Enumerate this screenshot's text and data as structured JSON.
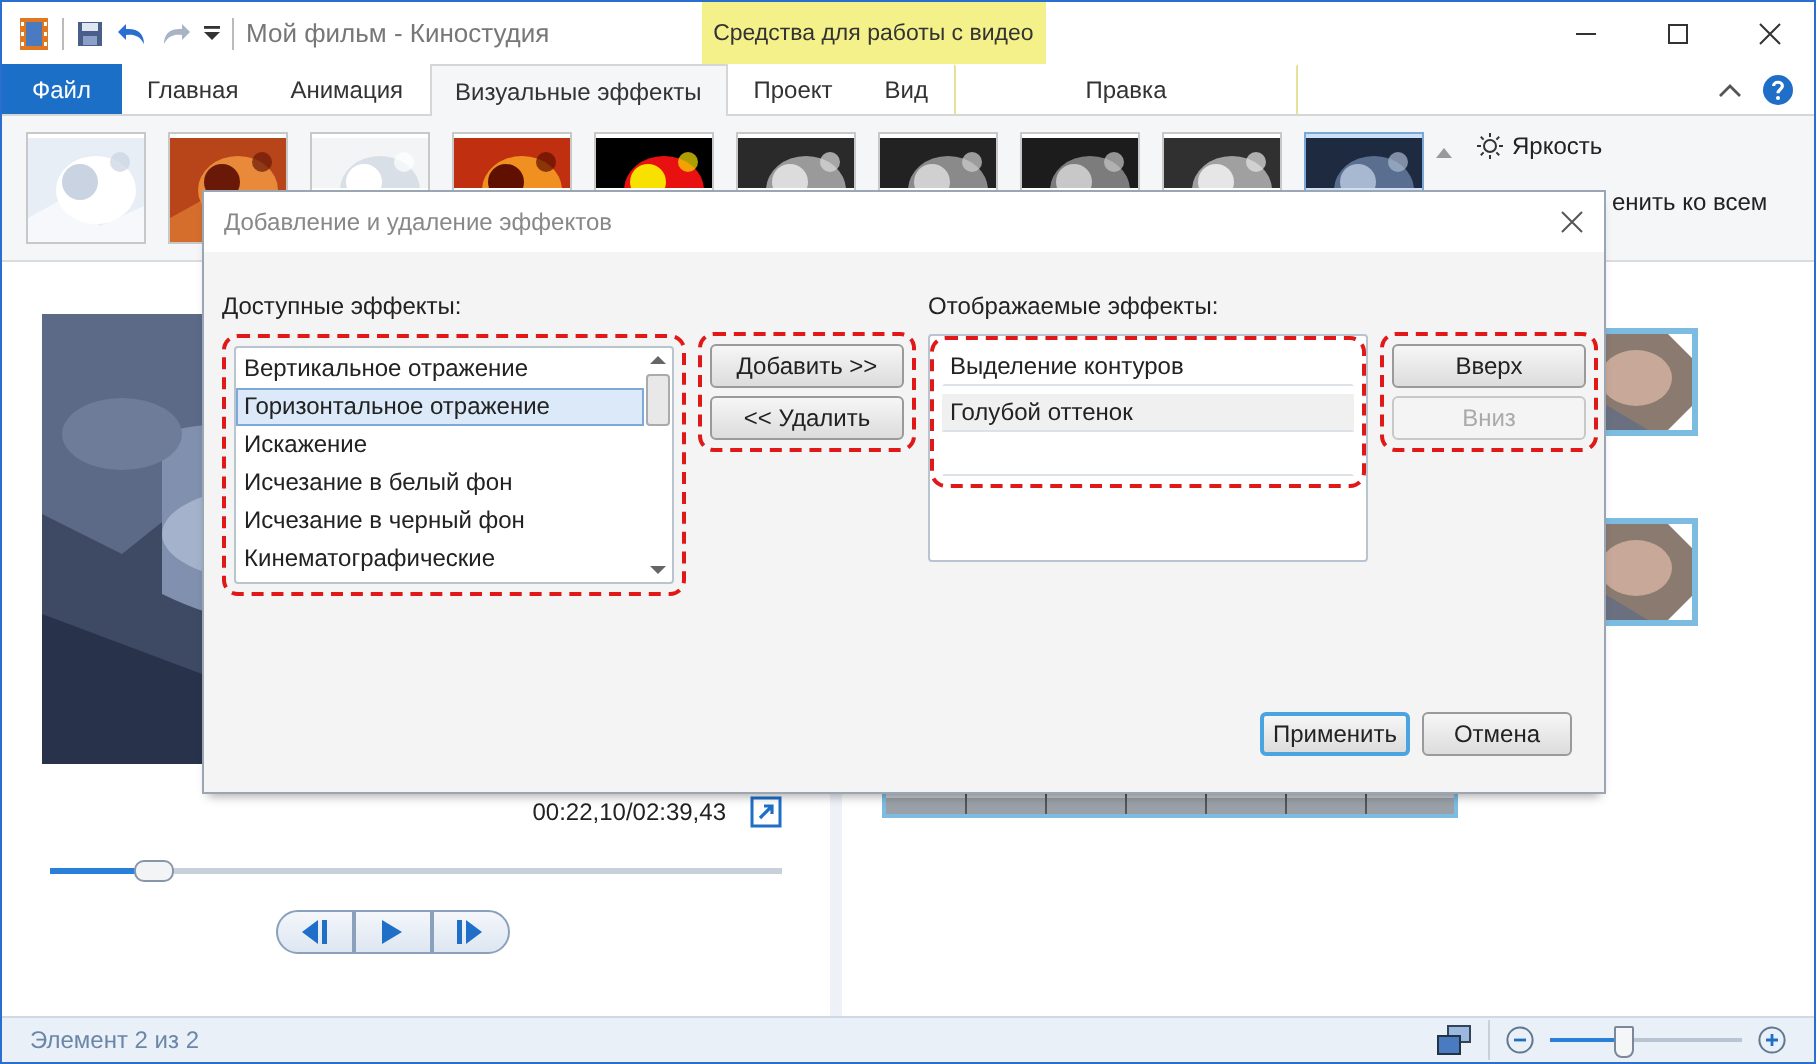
{
  "window": {
    "title": "Мой фильм - Киностудия",
    "context_group": "Средства для работы с видео"
  },
  "tabs": [
    {
      "label": "Файл",
      "kind": "file",
      "selected": false
    },
    {
      "label": "Главная",
      "kind": "tab",
      "selected": false
    },
    {
      "label": "Анимация",
      "kind": "tab",
      "selected": false
    },
    {
      "label": "Визуальные эффекты",
      "kind": "tab",
      "selected": true
    },
    {
      "label": "Проект",
      "kind": "tab",
      "selected": false
    },
    {
      "label": "Вид",
      "kind": "tab",
      "selected": false
    },
    {
      "label": "Правка",
      "kind": "context",
      "selected": false
    }
  ],
  "ribbon": {
    "gallery": [
      {
        "selected": false
      },
      {
        "selected": false
      },
      {
        "selected": false
      },
      {
        "selected": false
      },
      {
        "selected": false
      },
      {
        "selected": false
      },
      {
        "selected": false
      },
      {
        "selected": false
      },
      {
        "selected": false
      },
      {
        "selected": true
      }
    ],
    "commands": [
      "Яркость",
      "енить ко всем"
    ]
  },
  "preview": {
    "time": "00:22,10/02:39,43",
    "seek": {
      "level": 0.14
    }
  },
  "status_bar": {
    "text": "Элемент 2 из 2",
    "zoom": {
      "level": 0.38
    }
  },
  "dialog": {
    "title": "Добавление и удаление эффектов",
    "available": {
      "label": "Доступные эффекты:",
      "highlighted": true,
      "items": [
        {
          "label": "Вертикальное отражение",
          "selected": false
        },
        {
          "label": "Горизонтальное отражение",
          "selected": true
        },
        {
          "label": "Искажение",
          "selected": false
        },
        {
          "label": "Исчезание в белый фон",
          "selected": false
        },
        {
          "label": "Исчезание в черный фон",
          "selected": false
        },
        {
          "label": "Кинематографические",
          "selected": false
        }
      ]
    },
    "move_buttons": {
      "highlighted": true,
      "buttons": [
        {
          "label": "Добавить >>",
          "disabled": false
        },
        {
          "label": "<< Удалить",
          "disabled": false
        }
      ]
    },
    "displayed": {
      "label": "Отображаемые эффекты:",
      "highlighted": true,
      "items": [
        {
          "label": "Выделение контуров",
          "selected": false
        },
        {
          "label": "Голубой оттенок",
          "selected": true
        }
      ]
    },
    "order_buttons": {
      "highlighted": true,
      "buttons": [
        {
          "label": "Вверх",
          "disabled": false
        },
        {
          "label": "Вниз",
          "disabled": true
        }
      ]
    },
    "footer_buttons": [
      {
        "label": "Применить",
        "default": true
      },
      {
        "label": "Отмена",
        "default": false
      }
    ]
  }
}
